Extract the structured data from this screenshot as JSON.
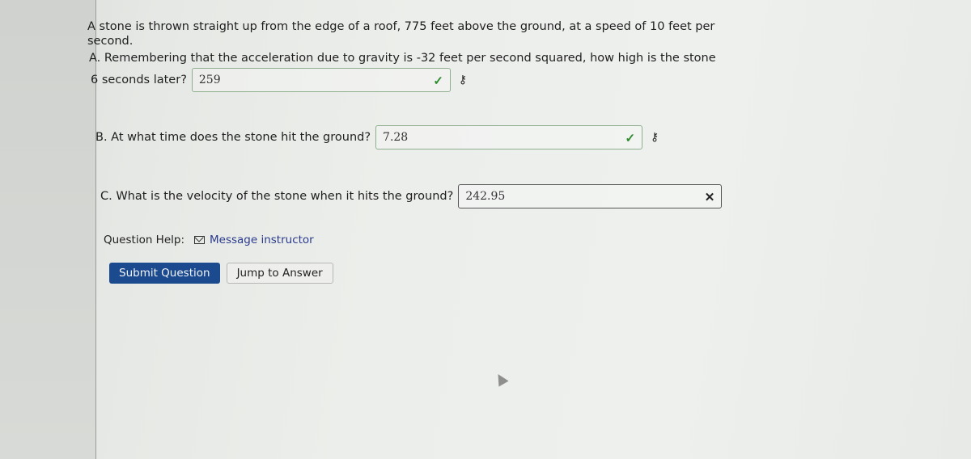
{
  "problem": {
    "intro": "A stone is thrown straight up from the edge of a roof, 775 feet above the ground, at a speed of 10 feet per second.",
    "part_a_text": "A. Remembering that the acceleration due to gravity is -32 feet per second squared, how high is the stone",
    "part_a_label": "6 seconds later?",
    "part_a_value": "259",
    "part_a_status": "✓",
    "part_b_label": "B. At what time does the stone hit the ground?",
    "part_b_value": "7.28",
    "part_b_status": "✓",
    "part_c_label": "C. What is the velocity of the stone when it hits the ground?",
    "part_c_value": "242.95",
    "part_c_status": "✕",
    "key_icon": "⚷"
  },
  "help": {
    "label": "Question Help:",
    "link": "Message instructor"
  },
  "buttons": {
    "submit": "Submit Question",
    "jump": "Jump to Answer"
  },
  "colors": {
    "correct": "#2e8b2e",
    "primary_button": "#1b4a8e",
    "link": "#2a3a8c"
  }
}
